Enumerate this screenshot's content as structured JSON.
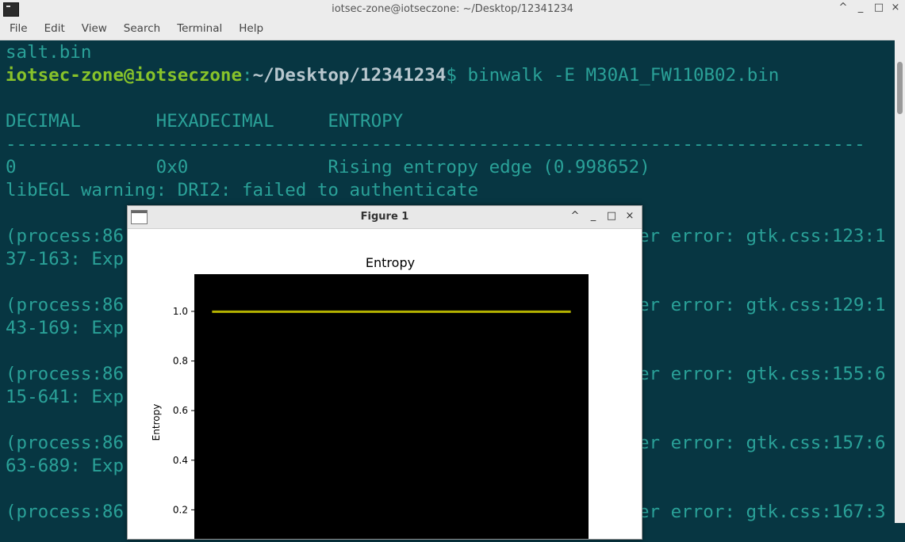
{
  "window": {
    "title": "iotsec-zone@iotseczone: ~/Desktop/12341234",
    "controls": {
      "chevron": "^",
      "minimize": "_",
      "maximize": "□",
      "close": "×"
    },
    "icon": "terminal-icon"
  },
  "menu": [
    "File",
    "Edit",
    "View",
    "Search",
    "Terminal",
    "Help"
  ],
  "terminal": {
    "prev_line": "salt.bin",
    "prompt_user": "iotsec-zone@iotseczone",
    "prompt_sep": ":",
    "prompt_path": "~/Desktop/12341234",
    "prompt_dollar": "$",
    "command": " binwalk -E M30A1_FW110B02.bin",
    "header": "DECIMAL       HEXADECIMAL     ENTROPY",
    "divider": "--------------------------------------------------------------------------------",
    "row": "0             0x0             Rising entropy edge (0.998652)",
    "warning": "libEGL warning: DRI2: failed to authenticate",
    "process_lines": [
      {
        "left": "(process:86",
        "right": "er error: gtk.css:123:1"
      },
      {
        "left": "37-163: Exp",
        "right": ""
      },
      {
        "left": "(process:86",
        "right": "er error: gtk.css:129:1"
      },
      {
        "left": "43-169: Exp",
        "right": ""
      },
      {
        "left": "(process:86",
        "right": "er error: gtk.css:155:6"
      },
      {
        "left": "15-641: Exp",
        "right": ""
      },
      {
        "left": "(process:86",
        "right": "er error: gtk.css:157:6"
      },
      {
        "left": "63-689: Exp",
        "right": ""
      },
      {
        "left": "(process:86",
        "right": "er error: gtk.css:167:3"
      }
    ]
  },
  "figure": {
    "title": "Figure 1",
    "controls": {
      "chevron": "^",
      "minimize": "_",
      "maximize": "□",
      "close": "×"
    }
  },
  "chart_data": {
    "type": "line",
    "title": "Entropy",
    "xlabel": "",
    "ylabel": "Entropy",
    "yticks": [
      0.2,
      0.4,
      0.6,
      0.8,
      1.0
    ],
    "ytick_labels": [
      "0.2",
      "0.4",
      "0.6",
      "0.8",
      "1.0"
    ],
    "ylim": [
      0.0,
      1.15
    ],
    "xlim": [
      0,
      1
    ],
    "background": "#000000",
    "line_color": "#b5b300",
    "series": [
      {
        "x": [
          0.045,
          0.955
        ],
        "y": [
          0.998652,
          0.998652
        ]
      }
    ]
  },
  "colors": {
    "terminal_bg": "#073642",
    "terminal_fg": "#2aa198",
    "prompt_user": "#88c32a",
    "prompt_path": "#b8c7ce"
  }
}
